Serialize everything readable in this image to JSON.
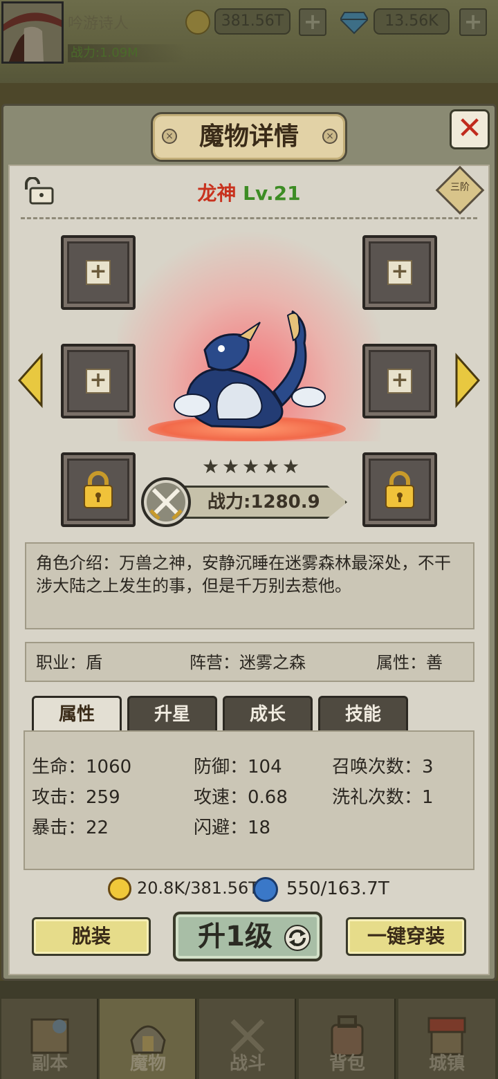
{
  "header": {
    "player_name": "吟游诗人",
    "power_label": "战力:1.09M",
    "gold": "381.56T",
    "diamonds": "13.56K"
  },
  "dialog": {
    "title": "魔物详情",
    "close": "✕"
  },
  "monster": {
    "name": "龙神",
    "level": "Lv.21",
    "grade": "三阶",
    "stars": 5,
    "power": "战力:1280.9",
    "description": "角色介绍：万兽之神，安静沉睡在迷雾森林最深处，不干涉大陆之上发生的事，但是千万别去惹他。",
    "job": "职业：盾",
    "faction": "阵营：迷雾之森",
    "attribute": "属性：善"
  },
  "tabs": [
    "属性",
    "升星",
    "成长",
    "技能"
  ],
  "stats": {
    "hp": "生命：1060",
    "def": "防御：104",
    "summons": "召唤次数：3",
    "atk": "攻击：259",
    "atkspd": "攻速：0.68",
    "baptism": "洗礼次数：1",
    "crit": "暴击：22",
    "dodge": "闪避：18"
  },
  "costs": {
    "gold": "20.8K/381.56T",
    "essence": "550/163.7T"
  },
  "buttons": {
    "unequip": "脱装",
    "levelup": "升1级",
    "equip_all": "一键穿装"
  },
  "nav": [
    "副本",
    "魔物",
    "战斗",
    "背包",
    "城镇"
  ],
  "colors": {
    "name_red": "#c8321e",
    "level_green": "#3d8c24",
    "spotlight": "#ff5a64"
  }
}
